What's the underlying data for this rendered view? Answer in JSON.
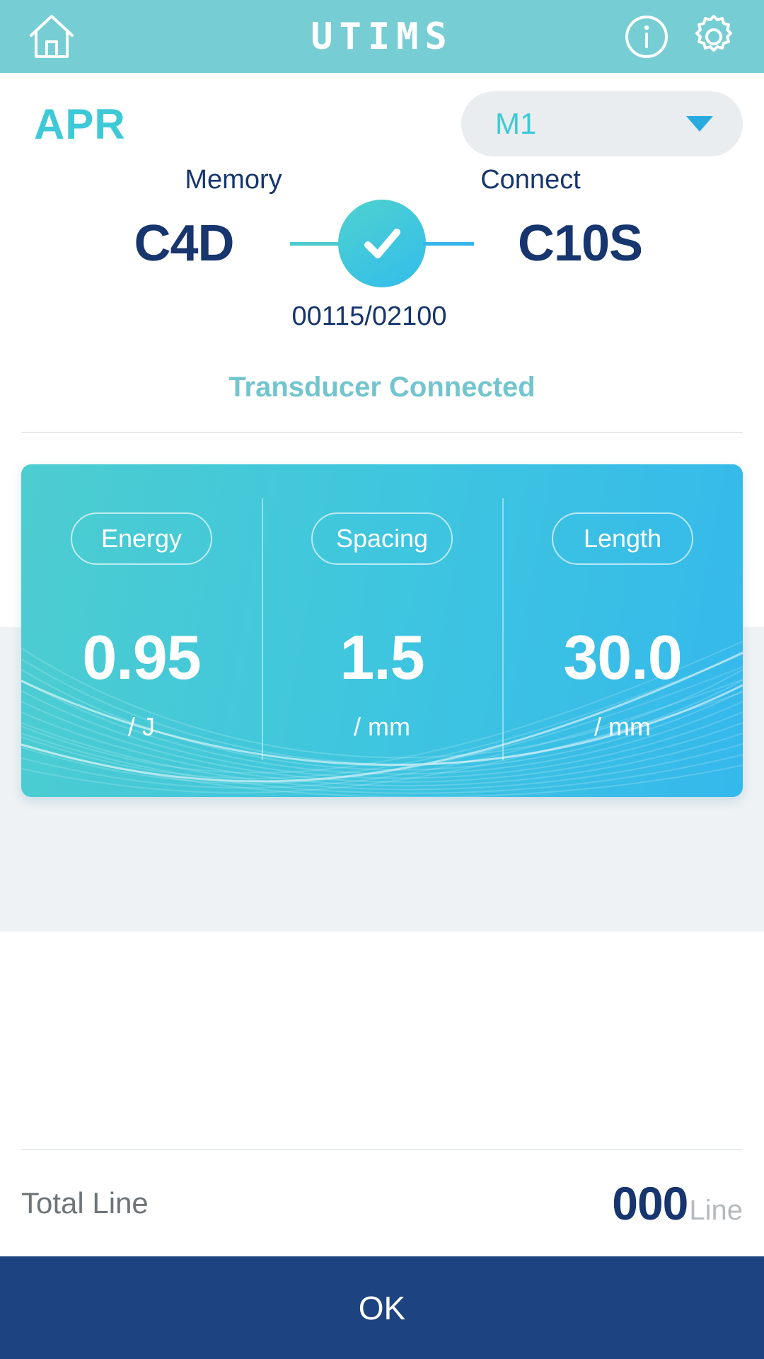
{
  "header": {
    "title": "UTIMS",
    "home_icon": "home-icon",
    "info_icon": "info-icon",
    "settings_icon": "gear-icon"
  },
  "mode": {
    "title": "APR"
  },
  "memory_select": {
    "value": "M1",
    "caret_icon": "chevron-down-icon"
  },
  "connection": {
    "memory_label": "Memory",
    "memory_code": "C4D",
    "connect_label": "Connect",
    "connect_code": "C10S",
    "counter": "00115/02100",
    "status": "Transducer Connected",
    "check_icon": "check-icon"
  },
  "parameters": [
    {
      "label": "Energy",
      "value": "0.95",
      "unit": "/ J"
    },
    {
      "label": "Spacing",
      "value": "1.5",
      "unit": "/ mm"
    },
    {
      "label": "Length",
      "value": "30.0",
      "unit": "/ mm"
    }
  ],
  "total": {
    "label": "Total Line",
    "value": "000",
    "unit": "Line"
  },
  "footer": {
    "ok_label": "OK"
  },
  "colors": {
    "header_teal": "#77cdd4",
    "accent_teal": "#3ec9d6",
    "navy": "#17356e",
    "status_teal": "#72c5ce",
    "card_from": "#4dcdd0",
    "card_to": "#35b8ec",
    "ok_navy": "#1d4380",
    "panel_gray": "#eef2f4"
  }
}
